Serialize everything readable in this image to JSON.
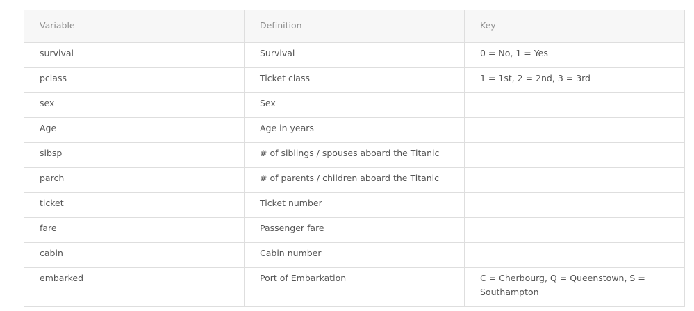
{
  "table": {
    "headers": [
      "Variable",
      "Definition",
      "Key"
    ],
    "rows": [
      [
        "survival",
        "Survival",
        "0 = No, 1 = Yes"
      ],
      [
        "pclass",
        "Ticket class",
        "1 = 1st, 2 = 2nd, 3 = 3rd"
      ],
      [
        "sex",
        "Sex",
        ""
      ],
      [
        "Age",
        "Age in years",
        ""
      ],
      [
        "sibsp",
        "# of siblings / spouses aboard the Titanic",
        ""
      ],
      [
        "parch",
        "# of parents / children aboard the Titanic",
        ""
      ],
      [
        "ticket",
        "Ticket number",
        ""
      ],
      [
        "fare",
        "Passenger fare",
        ""
      ],
      [
        "cabin",
        "Cabin number",
        ""
      ],
      [
        "embarked",
        "Port of Embarkation",
        "C = Cherbourg, Q = Queenstown, S = Southampton"
      ]
    ]
  }
}
